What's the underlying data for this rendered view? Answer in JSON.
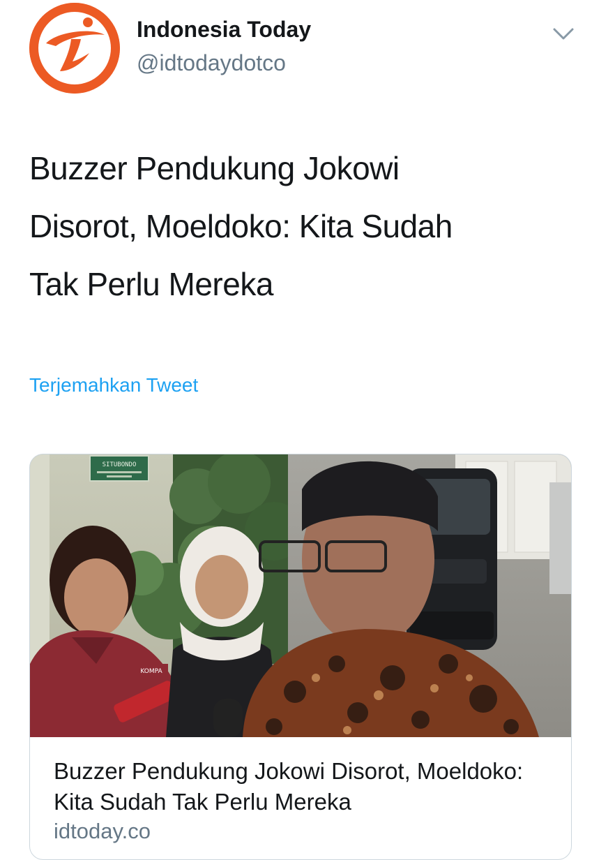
{
  "account": {
    "name": "Indonesia Today",
    "handle": "@idtodaydotco",
    "avatar_color": "#ec5a24"
  },
  "tweet": {
    "text_lines": [
      "Buzzer Pendukung Jokowi",
      "Disorot, Moeldoko: Kita Sudah",
      "Tak Perlu Mereka"
    ],
    "translate_label": "Terjemahkan Tweet"
  },
  "card": {
    "sign_text": "SITUBONDO",
    "microphone_text": "KOMPA",
    "title": "Buzzer Pendukung Jokowi Disorot, Moeldoko: Kita Sudah Tak Perlu Mereka",
    "domain": "idtoday.co"
  },
  "icons": {
    "menu": "chevron-down-icon"
  },
  "colors": {
    "link": "#1da1f2",
    "secondary_text": "#657786",
    "border": "#ccd6dd"
  }
}
